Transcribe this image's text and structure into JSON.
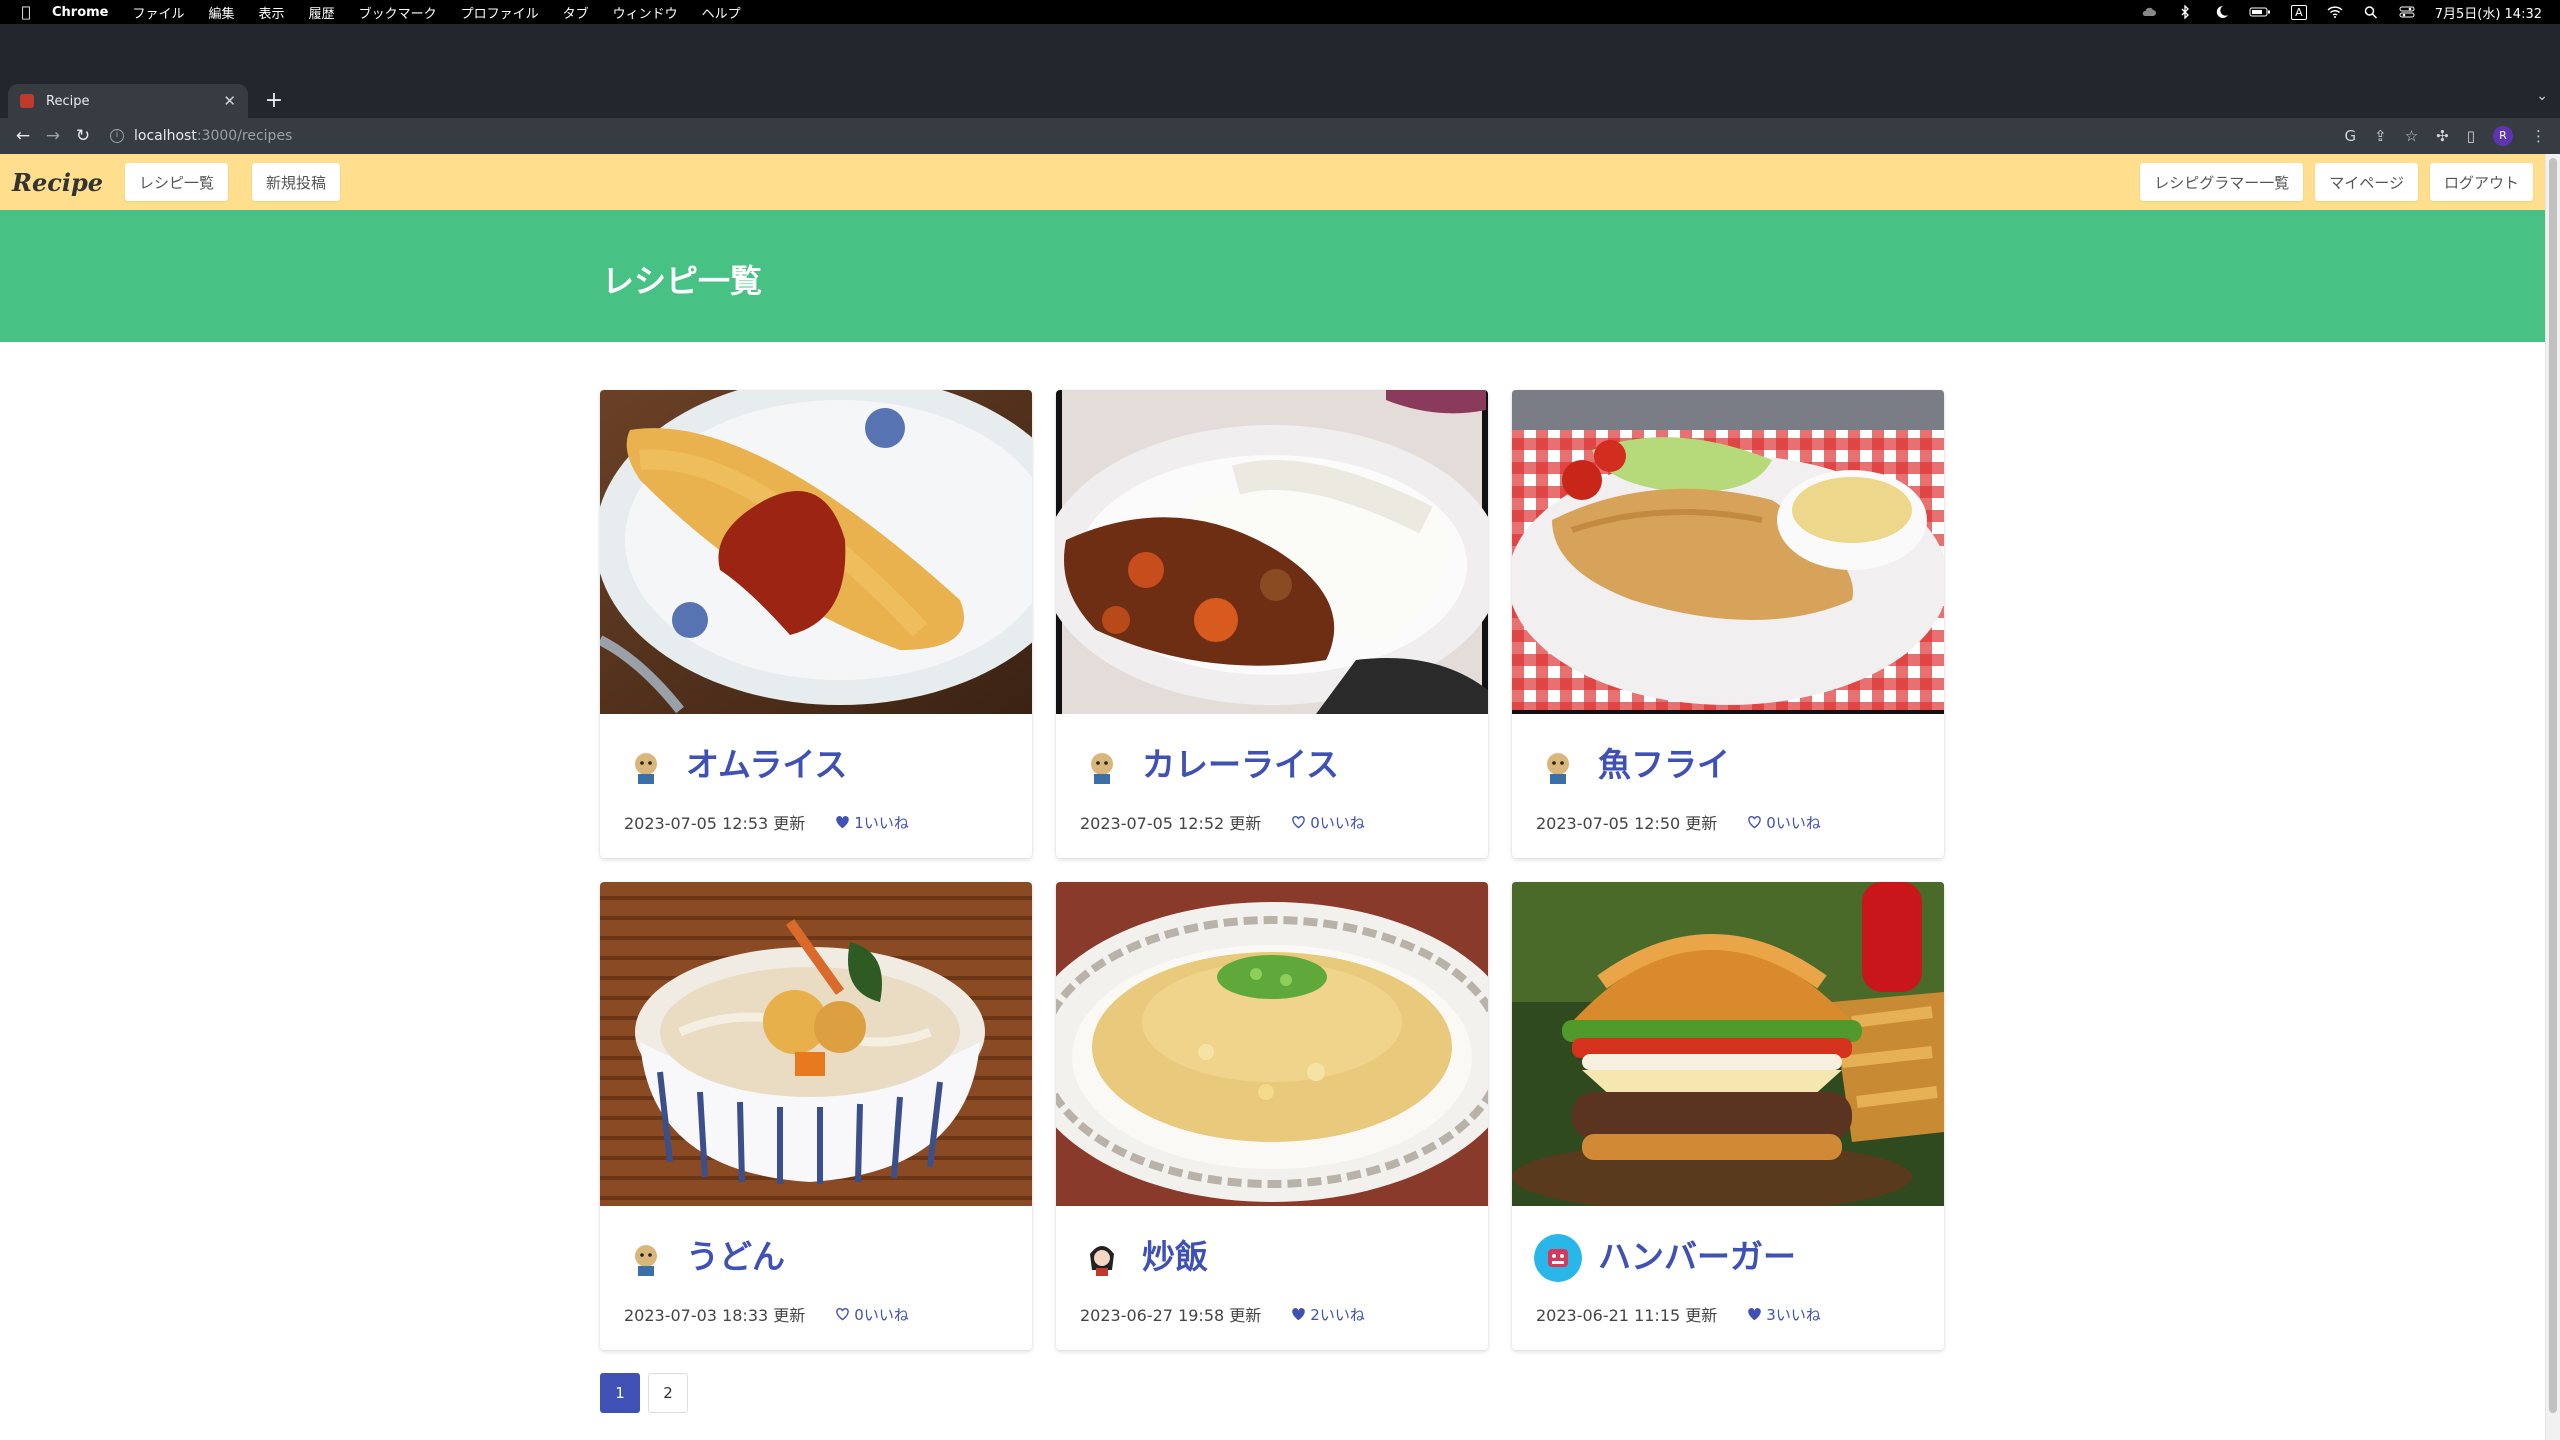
{
  "menubar": {
    "app": "Chrome",
    "items": [
      "ファイル",
      "編集",
      "表示",
      "履歴",
      "ブックマーク",
      "プロファイル",
      "タブ",
      "ウィンドウ",
      "ヘルプ"
    ],
    "status_icons": [
      "cloud-icon",
      "bluetooth-icon",
      "moon-icon",
      "battery-icon",
      "input-icon",
      "wifi-icon",
      "search-icon",
      "control-center-icon"
    ],
    "input_label": "A",
    "datetime": "7月5日(水) 14:32"
  },
  "browser": {
    "tab_title": "Recipe",
    "new_tab": "+",
    "url_host": "localhost",
    "url_path": ":3000/recipes",
    "profile_initial": "R"
  },
  "appnav": {
    "brand": "Recipe",
    "left": [
      "レシピ一覧",
      "新規投稿"
    ],
    "right": [
      "レシピグラマー一覧",
      "マイページ",
      "ログアウト"
    ]
  },
  "hero": {
    "title": "レシピ一覧"
  },
  "cards": [
    {
      "title": "オムライス",
      "updated": "2023-07-05 12:53 更新",
      "likes": "1いいね",
      "liked": true,
      "avatar": "bear"
    },
    {
      "title": "カレーライス",
      "updated": "2023-07-05 12:52 更新",
      "likes": "0いいね",
      "liked": false,
      "avatar": "bear"
    },
    {
      "title": "魚フライ",
      "updated": "2023-07-05 12:50 更新",
      "likes": "0いいね",
      "liked": false,
      "avatar": "bear"
    },
    {
      "title": "うどん",
      "updated": "2023-07-03 18:33 更新",
      "likes": "0いいね",
      "liked": false,
      "avatar": "bear"
    },
    {
      "title": "炒飯",
      "updated": "2023-06-27 19:58 更新",
      "likes": "2いいね",
      "liked": true,
      "avatar": "dark"
    },
    {
      "title": "ハンバーガー",
      "updated": "2023-06-21 11:15 更新",
      "likes": "3いいね",
      "liked": true,
      "avatar": "blue"
    }
  ],
  "pagination": {
    "pages": [
      "1",
      "2"
    ],
    "current": "1"
  },
  "colors": {
    "nav": "#ffdf8d",
    "hero": "#48c184",
    "accent": "#3f51b5"
  }
}
